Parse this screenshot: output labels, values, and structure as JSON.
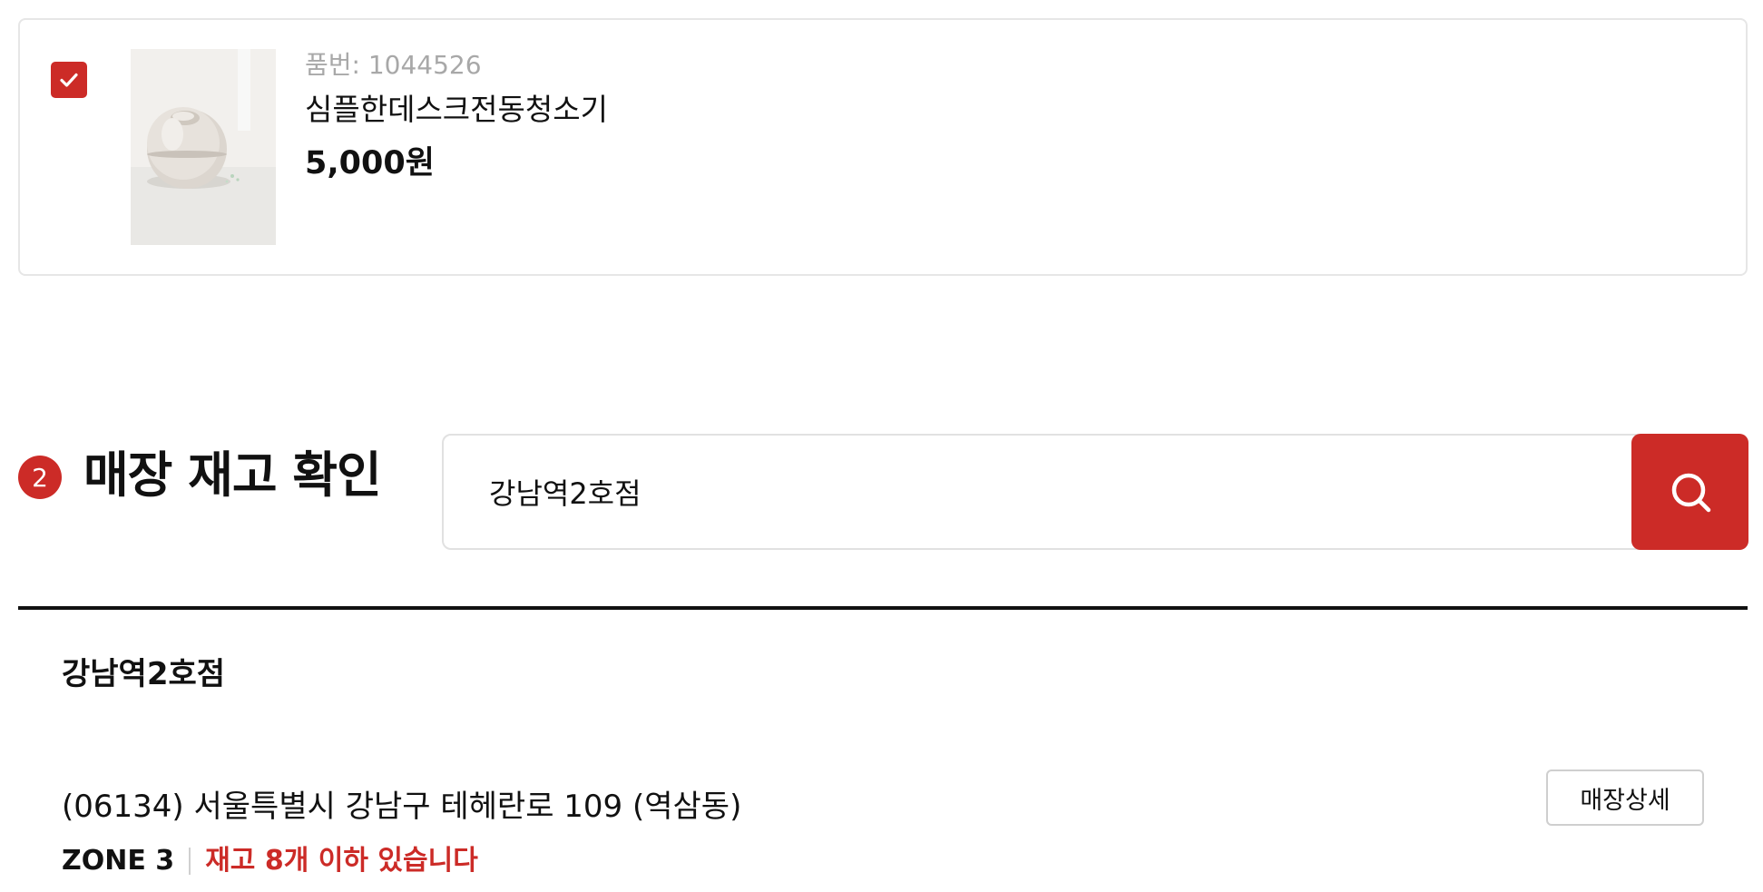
{
  "product": {
    "checked": true,
    "code": "품번: 1044526",
    "name": "심플한데스크전동청소기",
    "price": "5,000원"
  },
  "section": {
    "step_number": "2",
    "title": "매장 재고 확인"
  },
  "search": {
    "value": "강남역2호점",
    "icon": "search-icon"
  },
  "result": {
    "store_name": "강남역2호점",
    "address": "(06134) 서울특별시 강남구 테헤란로 109 (역삼동)",
    "detail_button_label": "매장상세",
    "zone": "ZONE 3",
    "stock_status": "재고 8개 이하 있습니다"
  },
  "colors": {
    "accent": "#cc2b27",
    "text": "#111111",
    "muted": "#a8a8a8",
    "border": "#e6e6e6"
  }
}
